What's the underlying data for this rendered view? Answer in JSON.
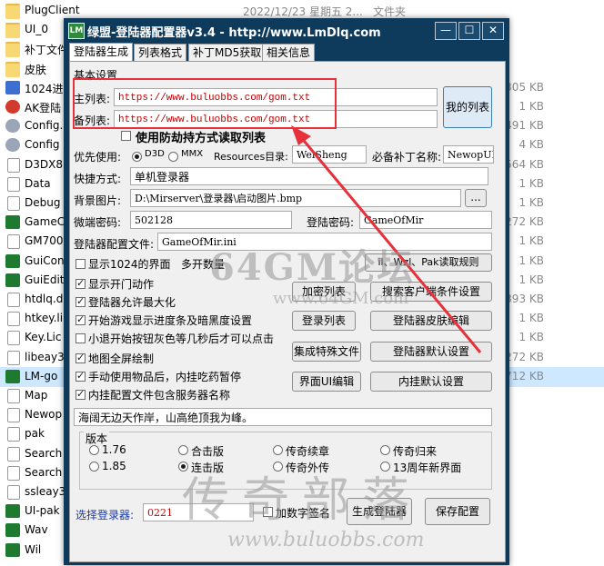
{
  "explorer": {
    "rows": [
      {
        "name": "PlugClient",
        "date": "2022/12/23 星期五 2...",
        "type": "文件夹",
        "size": "",
        "icon": "folder-icon"
      },
      {
        "name": "UI_0",
        "date": "",
        "type": "",
        "size": "",
        "icon": "folder-icon"
      },
      {
        "name": "补丁文件",
        "date": "",
        "type": "",
        "size": "",
        "icon": "folder-icon"
      },
      {
        "name": "皮肤",
        "date": "",
        "type": "",
        "size": "",
        "icon": "folder-icon"
      },
      {
        "name": "1024进",
        "date": "",
        "type": "",
        "size": "305 KB",
        "icon": "bmp-icon"
      },
      {
        "name": "AK登陆",
        "date": "",
        "type": "",
        "size": "1 KB",
        "icon": "app-icon"
      },
      {
        "name": "Config.",
        "date": "",
        "type": "",
        "size": "491 KB",
        "icon": "gear-icon"
      },
      {
        "name": "Config",
        "date": "",
        "type": "",
        "size": "4 KB",
        "icon": "gear-icon"
      },
      {
        "name": "D3DX8",
        "date": "",
        "type": "",
        "size": "564 KB",
        "icon": "file-icon"
      },
      {
        "name": "Data",
        "date": "",
        "type": "",
        "size": "1 KB",
        "icon": "file-icon"
      },
      {
        "name": "Debug",
        "date": "",
        "type": "",
        "size": "1 KB",
        "icon": "file-icon"
      },
      {
        "name": "GameC",
        "date": "",
        "type": "",
        "size": "272 KB",
        "icon": "app-icon"
      },
      {
        "name": "GM700",
        "date": "",
        "type": "",
        "size": "1 KB",
        "icon": "file-icon"
      },
      {
        "name": "GuiCon",
        "date": "",
        "type": "",
        "size": "1 KB",
        "icon": "app-icon"
      },
      {
        "name": "GuiEdit",
        "date": "",
        "type": "",
        "size": "1 KB",
        "icon": "app-icon"
      },
      {
        "name": "htdlq.d",
        "date": "",
        "type": "",
        "size": "393 KB",
        "icon": "file-icon"
      },
      {
        "name": "htkey.li",
        "date": "",
        "type": "",
        "size": "1 KB",
        "icon": "file-icon"
      },
      {
        "name": "Key.Lic",
        "date": "",
        "type": "",
        "size": "1 KB",
        "icon": "file-icon"
      },
      {
        "name": "libeay3",
        "date": "",
        "type": "",
        "size": "272 KB",
        "icon": "file-icon"
      },
      {
        "name": "LM-go",
        "date": "",
        "type": "",
        "size": "712 KB",
        "icon": "app-icon",
        "selected": true
      },
      {
        "name": "Map",
        "date": "",
        "type": "",
        "size": "",
        "icon": "file-icon"
      },
      {
        "name": "Newop",
        "date": "",
        "type": "",
        "size": "",
        "icon": "file-icon"
      },
      {
        "name": "pak",
        "date": "",
        "type": "",
        "size": "",
        "icon": "file-icon"
      },
      {
        "name": "Search",
        "date": "",
        "type": "",
        "size": "",
        "icon": "file-icon"
      },
      {
        "name": "Search",
        "date": "",
        "type": "",
        "size": "",
        "icon": "file-icon"
      },
      {
        "name": "ssleay3",
        "date": "",
        "type": "",
        "size": "",
        "icon": "file-icon"
      },
      {
        "name": "UI-pak",
        "date": "",
        "type": "",
        "size": "",
        "icon": "app-icon"
      },
      {
        "name": "Wav",
        "date": "",
        "type": "",
        "size": "",
        "icon": "app-icon"
      },
      {
        "name": "Wil",
        "date": "",
        "type": "",
        "size": "",
        "icon": "app-icon"
      }
    ]
  },
  "dialog": {
    "title": "绿盟-登陆器配置器v3.4 - http://www.LmDlq.com",
    "title_icon_text": "LM",
    "buttons": {
      "minimize": "—",
      "maximize": "☐",
      "close": "✕"
    },
    "tabs": [
      "登陆器生成",
      "列表格式",
      "补丁MD5获取",
      "相关信息"
    ],
    "basic_settings": "基本设置",
    "main_list_label": "主列表:",
    "main_list_value": "https://www.buluobbs.com/gom.txt",
    "backup_list_label": "备列表:",
    "backup_list_value": "https://www.buluobbs.com/gom.txt",
    "my_list_button": "我的列表",
    "anti_list_label": "使用防劫持方式读取列表",
    "priority_label": "优先使用:",
    "d3d_label": "D3D",
    "mmx_label": "MMX",
    "resources_label": "Resources目录:",
    "resources_value": "WeiSheng",
    "required_patch_label": "必备补丁名称:",
    "required_patch_value": "NewopUI",
    "shortcut_label": "快捷方式:",
    "shortcut_value": "单机登录器",
    "bg_image_label": "背景图片:",
    "bg_image_value": "D:\\Mirserver\\登录器\\启动图片.bmp",
    "browse_button": "...",
    "micro_password_label": "微端密码:",
    "micro_password_value": "502128",
    "login_password_label": "登陆密码:",
    "login_password_value": "GameOfMir",
    "config_file_label": "登陆器配置文件:",
    "config_file_value": "GameOfMir.ini",
    "options_left": [
      {
        "label": "显示1024的界面",
        "checked": false
      },
      {
        "label": "显示开门动作",
        "checked": true
      },
      {
        "label": "登陆器允许最大化",
        "checked": true
      },
      {
        "label": "开始游戏显示进度条及暗黑度设置",
        "checked": true
      },
      {
        "label": "小退开始按钮灰色等几秒后才可以点击",
        "checked": false
      },
      {
        "label": "地图全屏绘制",
        "checked": true
      },
      {
        "label": "手动使用物品后，内挂吃药暂停",
        "checked": true
      },
      {
        "label": "内挂配置文件包含服务器名称",
        "checked": true
      }
    ],
    "multi_client_label": "多开数量",
    "read_rule_button": "il、Wzl、Pak读取规则",
    "encrypt_list_button": "加密列表",
    "search_client_button": "搜索客户端条件设置",
    "login_list_button": "登录列表",
    "login_skin_button": "登陆器皮肤编辑",
    "special_button": "集成特殊文件",
    "login_default_button": "登陆器默认设置",
    "ui_edit_button": "界面UI编辑",
    "plugin_default_button": "内挂默认设置",
    "motto": "海阔无边天作岸，山高绝顶我为峰。",
    "version_label": "版本",
    "versions": [
      [
        "1.76",
        "合击版",
        "传奇续章",
        "传奇归来"
      ],
      [
        "1.85",
        "连击版",
        "传奇外传",
        "13周年新界面"
      ]
    ],
    "selected_version": "连击版",
    "select_login_label": "选择登录器:",
    "select_login_value": "0221",
    "digital_sign_label": "加数字签名",
    "generate_button": "生成登陆器",
    "save_button": "保存配置"
  },
  "watermarks": {
    "main": "64GM论坛",
    "url": "www.64GM.com",
    "bottom": "传奇部落",
    "bottom_url": "www.buluobbs.com"
  },
  "colors": {
    "title_bg": "#0e3b5c",
    "highlight": "#e8303a",
    "url_text": "#c00000"
  }
}
